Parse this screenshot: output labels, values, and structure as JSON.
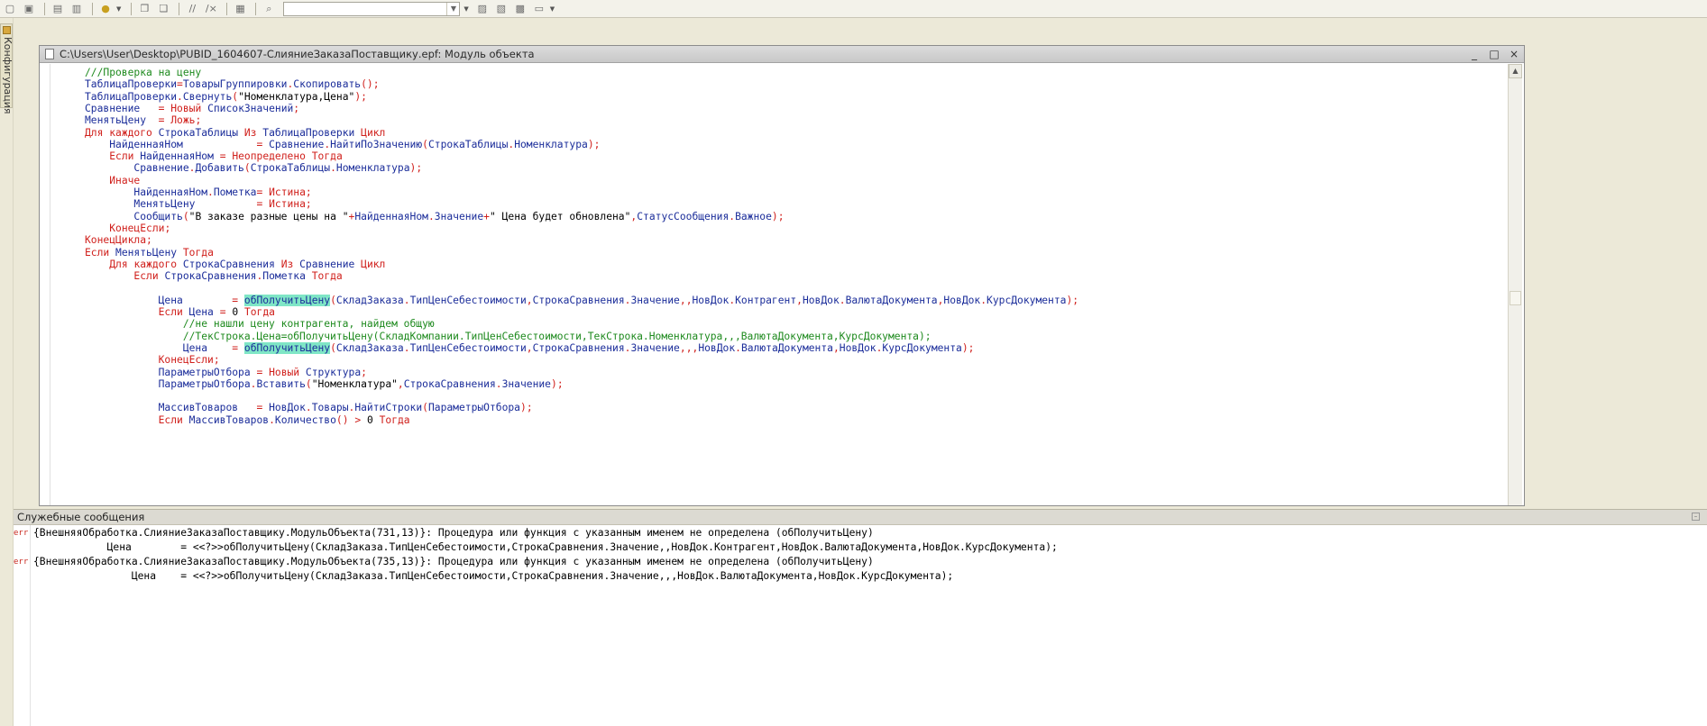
{
  "toolbar": {
    "icons": [
      "new-icon",
      "open-icon",
      "save-icon",
      "save-all-icon",
      "run-icon",
      "copy-icon",
      "paste-icon",
      "comment-icon",
      "uncomment-icon",
      "indent-icon",
      "find-icon",
      "bookmark-icon",
      "bookmark-next-icon",
      "bookmark-prev-icon",
      "bookmark-clear-icon"
    ],
    "combo_value": ""
  },
  "side_tab": {
    "label": "Конфигурация"
  },
  "editor_window": {
    "title": "C:\\Users\\User\\Desktop\\PUBID_1604607-СлияниеЗаказаПоставщику.epf: Модуль объекта",
    "minimize": "_",
    "restore": "□",
    "close": "×"
  },
  "code_lines": [
    "///Проверка на цену",
    "ТаблицаПроверки=ТоварыГруппировки.Скопировать();",
    "ТаблицаПроверки.Свернуть(\"Номенклатура,Цена\");",
    "Сравнение   = Новый СписокЗначений;",
    "МенятьЦену  = Ложь;",
    "Для каждого СтрокаТаблицы Из ТаблицаПроверки Цикл",
    "    НайденнаяНом            = Сравнение.НайтиПоЗначению(СтрокаТаблицы.Номенклатура);",
    "    Если НайденнаяНом = Неопределено Тогда",
    "        Сравнение.Добавить(СтрокаТаблицы.Номенклатура);",
    "    Иначе",
    "        НайденнаяНом.Пометка= Истина;",
    "        МенятьЦену          = Истина;",
    "        Сообщить(\"В заказе разные цены на \"+НайденнаяНом.Значение+\" Цена будет обновлена\",СтатусСообщения.Важное);",
    "    КонецЕсли;",
    "КонецЦикла;",
    "Если МенятьЦену Тогда",
    "    Для каждого СтрокаСравнения Из Сравнение Цикл",
    "        Если СтрокаСравнения.Пометка Тогда",
    "",
    "            Цена        = обПолучитьЦену(СкладЗаказа.ТипЦенСебестоимости,СтрокаСравнения.Значение,,НовДок.Контрагент,НовДок.ВалютаДокумента,НовДок.КурсДокумента);",
    "            Если Цена = 0 Тогда",
    "                //не нашли цену контрагента, найдем общую",
    "                //ТекСтрока.Цена=обПолучитьЦену(СкладКомпании.ТипЦенСебестоимости,ТекСтрока.Номенклатура,,,ВалютаДокумента,КурсДокумента);",
    "                Цена    = обПолучитьЦену(СкладЗаказа.ТипЦенСебестоимости,СтрокаСравнения.Значение,,,НовДок.ВалютаДокумента,НовДок.КурсДокумента);",
    "            КонецЕсли;",
    "            ПараметрыОтбора = Новый Структура;",
    "            ПараметрыОтбора.Вставить(\"Номенклатура\",СтрокаСравнения.Значение);",
    "",
    "            МассивТоваров   = НовДок.Товары.НайтиСтроки(ПараметрыОтбора);",
    "            Если МассивТоваров.Количество() > 0 Тогда"
  ],
  "messages": {
    "title": "Служебные сообщения",
    "err_label": "err",
    "lines": [
      "{ВнешняяОбработка.СлияниеЗаказаПоставщику.МодульОбъекта(731,13)}: Процедура или функция с указанным именем не определена (обПолучитьЦену)",
      "            Цена        = <<?>>обПолучитьЦену(СкладЗаказа.ТипЦенСебестоимости,СтрокаСравнения.Значение,,НовДок.Контрагент,НовДок.ВалютаДокумента,НовДок.КурсДокумента);",
      "{ВнешняяОбработка.СлияниеЗаказаПоставщику.МодульОбъекта(735,13)}: Процедура или функция с указанным именем не определена (обПолучитьЦену)",
      "                Цена    = <<?>>обПолучитьЦену(СкладЗаказа.ТипЦенСебестоимости,СтрокаСравнения.Значение,,,НовДок.ВалютаДокумента,НовДок.КурсДокумента);"
    ]
  }
}
